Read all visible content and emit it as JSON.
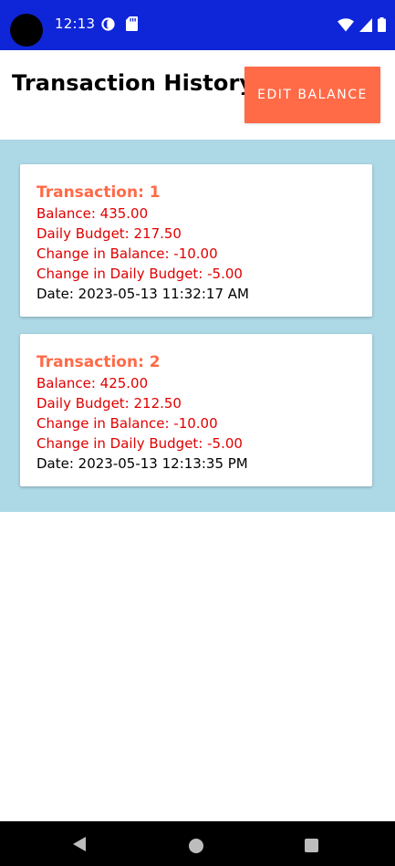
{
  "status_bar": {
    "time": "12:13",
    "left_icons": [
      "data-saver-icon",
      "sd-card-icon"
    ],
    "right_icons": [
      "wifi-icon",
      "cell-signal-icon",
      "battery-icon"
    ]
  },
  "header": {
    "title": "Transaction History",
    "edit_button_label": "Edit Balance"
  },
  "colors": {
    "status_bar": "#0f25d8",
    "accent": "#ff6a47",
    "panel_background": "#add8e6",
    "value_text": "#e00000"
  },
  "transactions": [
    {
      "title": "Transaction: 1",
      "balance": "Balance: 435.00",
      "daily_budget": "Daily Budget: 217.50",
      "change_balance": "Change in Balance: -10.00",
      "change_daily_budget": "Change in Daily Budget: -5.00",
      "date": "Date: 2023-05-13 11:32:17 AM"
    },
    {
      "title": "Transaction: 2",
      "balance": "Balance: 425.00",
      "daily_budget": "Daily Budget: 212.50",
      "change_balance": "Change in Balance: -10.00",
      "change_daily_budget": "Change in Daily Budget: -5.00",
      "date": "Date: 2023-05-13 12:13:35 PM"
    }
  ],
  "nav_bar": {
    "icons": [
      "back-icon",
      "home-icon",
      "recents-icon"
    ]
  }
}
